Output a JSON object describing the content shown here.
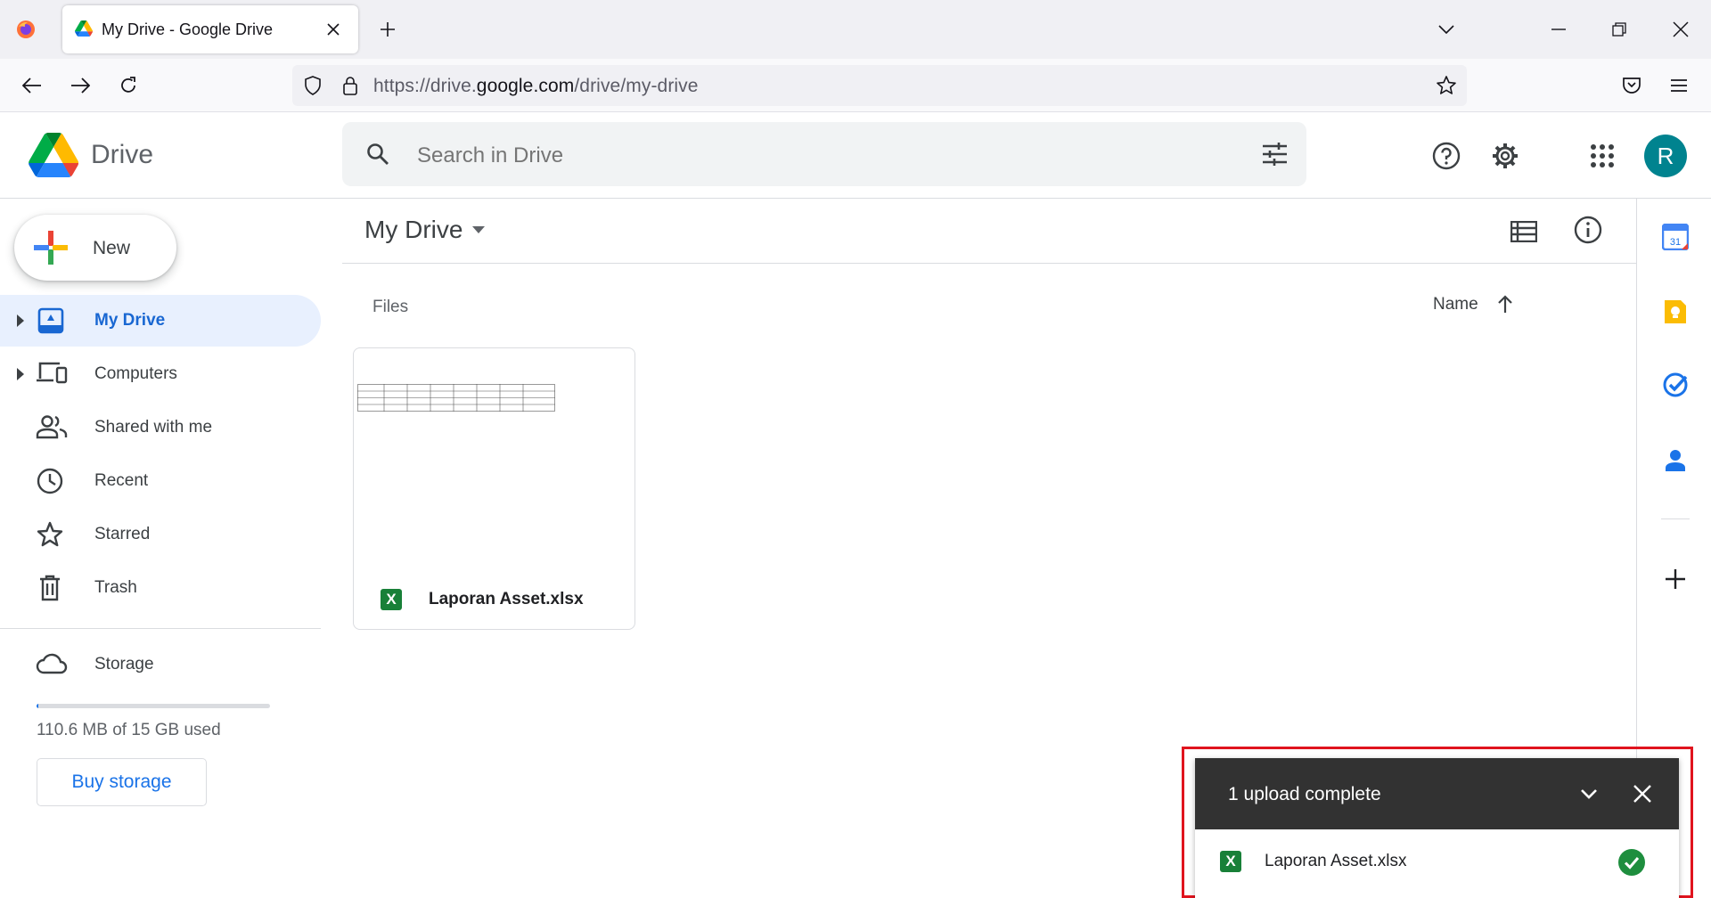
{
  "browser": {
    "tab_title": "My Drive - Google Drive",
    "url_prefix": "https://drive.",
    "url_domain": "google.com",
    "url_path": "/drive/my-drive"
  },
  "header": {
    "app_name": "Drive",
    "search_placeholder": "Search in Drive",
    "avatar_letter": "R"
  },
  "sidebar": {
    "new_label": "New",
    "items": [
      {
        "label": "My Drive",
        "icon": "my-drive-icon",
        "active": true
      },
      {
        "label": "Computers",
        "icon": "computers-icon"
      },
      {
        "label": "Shared with me",
        "icon": "shared-icon"
      },
      {
        "label": "Recent",
        "icon": "clock-icon"
      },
      {
        "label": "Starred",
        "icon": "star-icon"
      },
      {
        "label": "Trash",
        "icon": "trash-icon"
      }
    ],
    "storage_label": "Storage",
    "storage_used_text": "110.6 MB of 15 GB used",
    "storage_fraction": 0.007,
    "buy_storage": "Buy storage"
  },
  "main": {
    "title": "My Drive",
    "section_label": "Files",
    "sort_label": "Name",
    "files": [
      {
        "name": "Laporan Asset.xlsx",
        "type_icon": "X"
      }
    ]
  },
  "upload_panel": {
    "title": "1 upload complete",
    "items": [
      {
        "name": "Laporan Asset.xlsx",
        "type_icon": "X",
        "status": "complete"
      }
    ]
  },
  "side_panel": {
    "calendar_day": "31"
  },
  "colors": {
    "accent": "#1a73e8",
    "active_nav_bg": "#e8f0fe",
    "highlight_box": "#e0141e",
    "success": "#1e8e3e",
    "excel": "#188038"
  }
}
